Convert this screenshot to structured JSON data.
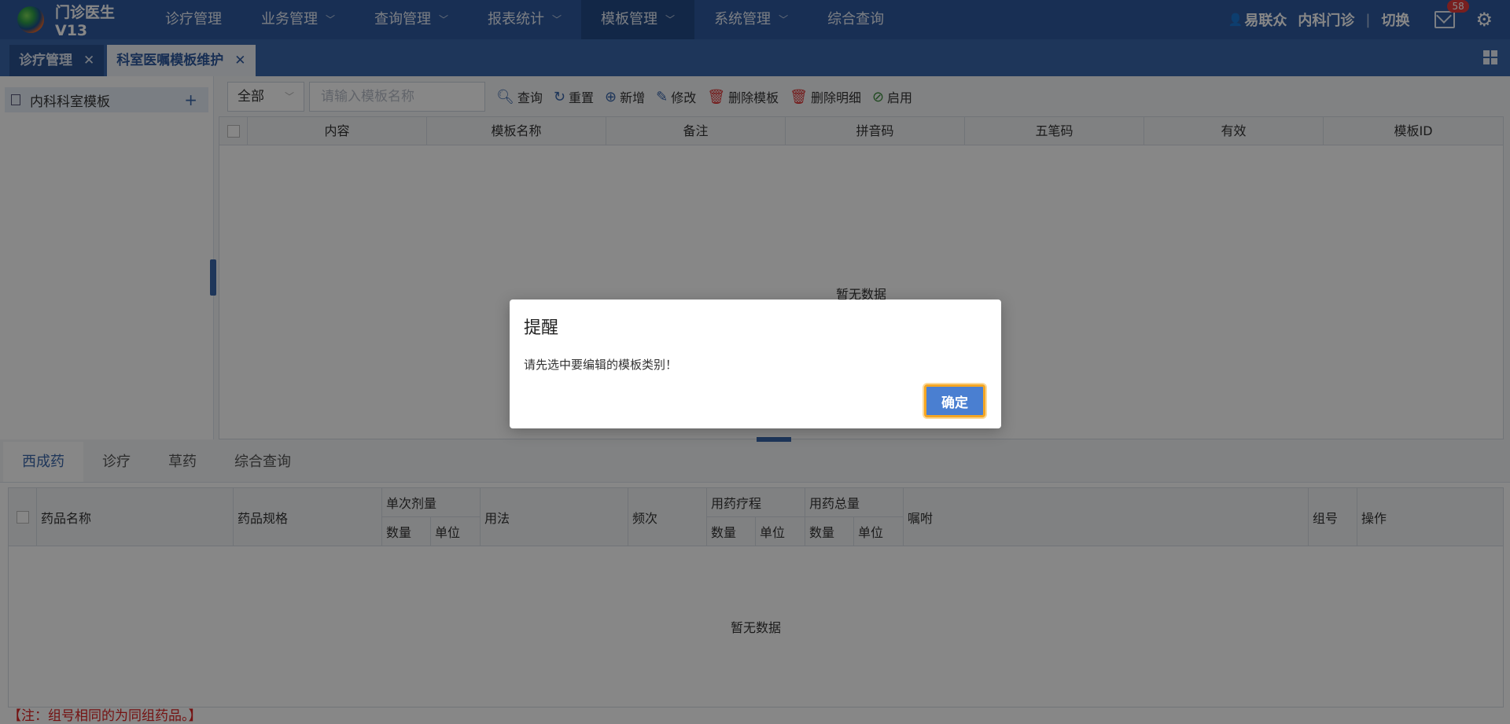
{
  "app": {
    "title": "门诊医生V13"
  },
  "nav": {
    "items": [
      {
        "label": "诊疗管理"
      },
      {
        "label": "业务管理"
      },
      {
        "label": "查询管理"
      },
      {
        "label": "报表统计"
      },
      {
        "label": "模板管理"
      },
      {
        "label": "系统管理"
      },
      {
        "label": "综合查询"
      }
    ],
    "active": "模板管理"
  },
  "user": {
    "name": "易联众",
    "dept": "内科门诊",
    "switch_label": "切换",
    "mail_count": "58"
  },
  "tabs": [
    {
      "label": "诊疗管理",
      "close": "✕"
    },
    {
      "label": "科室医嘱模板维护",
      "close": "✕"
    }
  ],
  "sidebar": {
    "item_label": "内科科室模板",
    "add_icon": "+"
  },
  "toolbar": {
    "filter_value": "全部",
    "search_placeholder": "请输入模板名称",
    "buttons": [
      {
        "label": "查询",
        "icon": "search-icon"
      },
      {
        "label": "重置",
        "icon": "refresh-icon"
      },
      {
        "label": "新增",
        "icon": "plus-circle-icon"
      },
      {
        "label": "修改",
        "icon": "edit-icon"
      },
      {
        "label": "删除模板",
        "icon": "trash-icon"
      },
      {
        "label": "删除明细",
        "icon": "trash-icon"
      },
      {
        "label": "启用",
        "icon": "check-circle-icon"
      }
    ]
  },
  "template_table": {
    "columns": [
      "内容",
      "模板名称",
      "备注",
      "拼音码",
      "五笔码",
      "有效",
      "模板ID"
    ],
    "empty_text": "暂无数据"
  },
  "detail_tabs": [
    "西成药",
    "诊疗",
    "草药",
    "综合查询"
  ],
  "drug_table": {
    "headers": {
      "drug_name": "药品名称",
      "spec": "药品规格",
      "single_dose": "单次剂量",
      "qty": "数量",
      "unit": "单位",
      "usage": "用法",
      "frequency": "频次",
      "course": "用药疗程",
      "total": "用药总量",
      "advice": "嘱咐",
      "group": "组号",
      "action": "操作"
    },
    "empty_text": "暂无数据"
  },
  "note": "【注：组号相同的为同组药品。】",
  "dialog": {
    "title": "提醒",
    "message": "请先选中要编辑的模板类别！",
    "ok_label": "确定"
  }
}
